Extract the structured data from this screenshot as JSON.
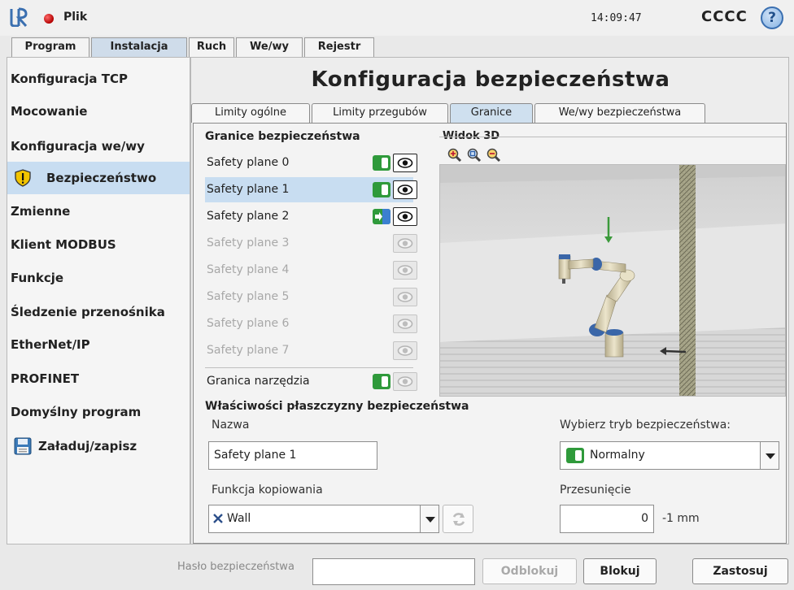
{
  "titlebar": {
    "file_label": "Plik",
    "clock": "14:09:47",
    "robot_name": "CCCC",
    "help": "?"
  },
  "main_tabs": [
    {
      "label": "Program",
      "active": false
    },
    {
      "label": "Instalacja",
      "active": true
    },
    {
      "label": "Ruch",
      "active": false
    },
    {
      "label": "We/wy",
      "active": false
    },
    {
      "label": "Rejestr",
      "active": false
    }
  ],
  "sidebar": {
    "items": [
      {
        "label": "Konfiguracja TCP"
      },
      {
        "label": "Mocowanie"
      },
      {
        "label": "Konfiguracja we/wy"
      },
      {
        "label": "Bezpieczeństwo",
        "icon": "shield-warning-icon",
        "active": true
      },
      {
        "label": "Zmienne"
      },
      {
        "label": "Klient MODBUS"
      },
      {
        "label": "Funkcje"
      },
      {
        "label": "Śledzenie przenośnika"
      },
      {
        "label": "EtherNet/IP"
      },
      {
        "label": "PROFINET"
      },
      {
        "label": "Domyślny program"
      },
      {
        "label": "Załaduj/zapisz",
        "icon": "floppy-disk-icon"
      }
    ]
  },
  "main": {
    "title": "Konfiguracja bezpieczeństwa",
    "sub_tabs": [
      {
        "label": "Limity ogólne"
      },
      {
        "label": "Limity przegubów"
      },
      {
        "label": "Granice",
        "active": true
      },
      {
        "label": "We/wy bezpieczeństwa"
      }
    ],
    "boundaries_title": "Granice bezpieczeństwa",
    "planes": [
      {
        "label": "Safety plane 0",
        "mode": "normal",
        "visible": true
      },
      {
        "label": "Safety plane 1",
        "mode": "normal",
        "visible": true,
        "selected": true
      },
      {
        "label": "Safety plane 2",
        "mode": "trigger",
        "visible": true
      },
      {
        "label": "Safety plane 3",
        "mode": "disabled",
        "visible": false
      },
      {
        "label": "Safety plane 4",
        "mode": "disabled",
        "visible": false
      },
      {
        "label": "Safety plane 5",
        "mode": "disabled",
        "visible": false
      },
      {
        "label": "Safety plane 6",
        "mode": "disabled",
        "visible": false
      },
      {
        "label": "Safety plane 7",
        "mode": "disabled",
        "visible": false
      }
    ],
    "tool_boundary": {
      "label": "Granica narzędzia",
      "mode": "normal",
      "visible": false
    },
    "view3d_title": "Widok 3D",
    "properties_title": "Właściwości płaszczyzny bezpieczeństwa",
    "name_label": "Nazwa",
    "name_value": "Safety plane 1",
    "copy_label": "Funkcja kopiowania",
    "copy_value": "Wall",
    "mode_label": "Wybierz tryb bezpieczeństwa:",
    "mode_value": "Normalny",
    "offset_label": "Przesunięcie",
    "offset_value": "0",
    "offset_unit": "-1 mm"
  },
  "bottom": {
    "password_label": "Hasło bezpieczeństwa",
    "password_value": "",
    "unlock_label": "Odblokuj",
    "lock_label": "Blokuj",
    "apply_label": "Zastosuj"
  },
  "colors": {
    "accent_selected": "#c8ddf1",
    "normal_mode_green": "#2f9a3b",
    "reduced_mode_blue": "#3b6fd0"
  }
}
